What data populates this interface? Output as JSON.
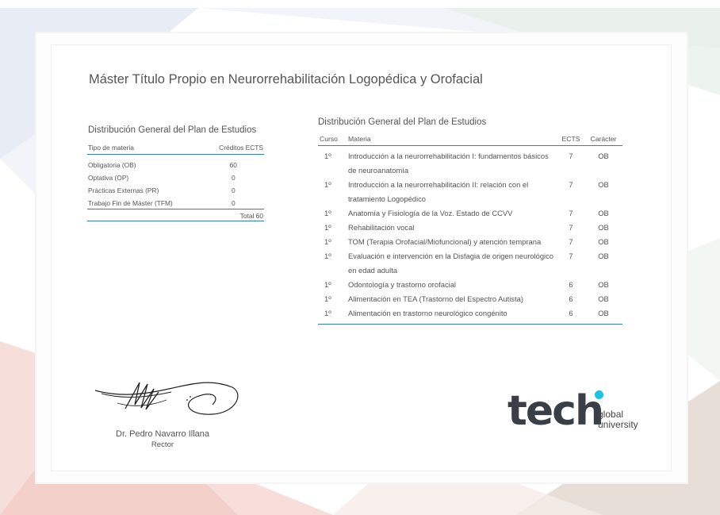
{
  "document": {
    "title": "Máster Título Propio en Neurorrehabilitación Logopédica y Orofacial"
  },
  "left_table": {
    "heading": "Distribución General del Plan de Estudios",
    "col_type": "Tipo de materia",
    "col_credits": "Créditos ECTS",
    "rows": [
      {
        "type": "Obligatoria (OB)",
        "credits": "60"
      },
      {
        "type": "Optativa (OP)",
        "credits": "0"
      },
      {
        "type": "Prácticas Externas (PR)",
        "credits": "0"
      },
      {
        "type": "Trabajo Fin de Máster (TFM)",
        "credits": "0"
      }
    ],
    "total": "Total 60"
  },
  "right_table": {
    "heading": "Distribución General del Plan de Estudios",
    "col_curso": "Curso",
    "col_materia": "Materia",
    "col_ects": "ECTS",
    "col_caracter": "Carácter",
    "rows": [
      {
        "curso": "1º",
        "materia": "Introducción a la neurorrehabilitación I: fundamentos básicos de neuroanatomía",
        "ects": "7",
        "caracter": "OB"
      },
      {
        "curso": "1º",
        "materia": "Introducción a la neurorrehabilitación II: relación con el tratamiento Logopédico",
        "ects": "7",
        "caracter": "OB"
      },
      {
        "curso": "1º",
        "materia": "Anatomía y Fisiología de la Voz. Estado de CCVV",
        "ects": "7",
        "caracter": "OB"
      },
      {
        "curso": "1º",
        "materia": "Rehabilitación vocal",
        "ects": "7",
        "caracter": "OB"
      },
      {
        "curso": "1º",
        "materia": "TOM (Terapia Orofacial/Miofuncional) y atención temprana",
        "ects": "7",
        "caracter": "OB"
      },
      {
        "curso": "1º",
        "materia": "Evaluación e intervención en la Disfagia de origen neurológico en edad adulta",
        "ects": "7",
        "caracter": "OB"
      },
      {
        "curso": "1º",
        "materia": "Odontología y trastorno orofacial",
        "ects": "6",
        "caracter": "OB"
      },
      {
        "curso": "1º",
        "materia": "Alimentación en TEA (Trastorno del Espectro Autista)",
        "ects": "6",
        "caracter": "OB"
      },
      {
        "curso": "1º",
        "materia": "Alimentación en trastorno neurológico congénito",
        "ects": "6",
        "caracter": "OB"
      }
    ]
  },
  "signature": {
    "name": "Dr. Pedro Navarro Illana",
    "role": "Rector"
  },
  "logo": {
    "wordmark": "tech",
    "line1": "global",
    "line2": "university"
  },
  "colors": {
    "accent": "#3a7bbf",
    "logo_dot": "#18c4e0",
    "logo_text": "#3a3f47"
  }
}
